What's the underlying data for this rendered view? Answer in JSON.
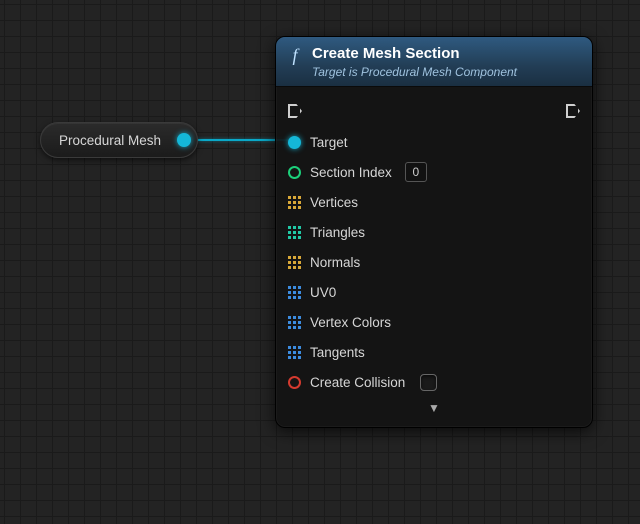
{
  "variable_node": {
    "label": "Procedural Mesh"
  },
  "function_node": {
    "icon_glyph": "f",
    "title": "Create Mesh Section",
    "subtitle": "Target is Procedural Mesh Component",
    "pins": {
      "target": "Target",
      "section_index": {
        "label": "Section Index",
        "value": "0"
      },
      "vertices": "Vertices",
      "triangles": "Triangles",
      "normals": "Normals",
      "uv0": "UV0",
      "vertex_colors": "Vertex Colors",
      "tangents": "Tangents",
      "create_collision": "Create Collision"
    },
    "expand_glyph": "▼"
  }
}
